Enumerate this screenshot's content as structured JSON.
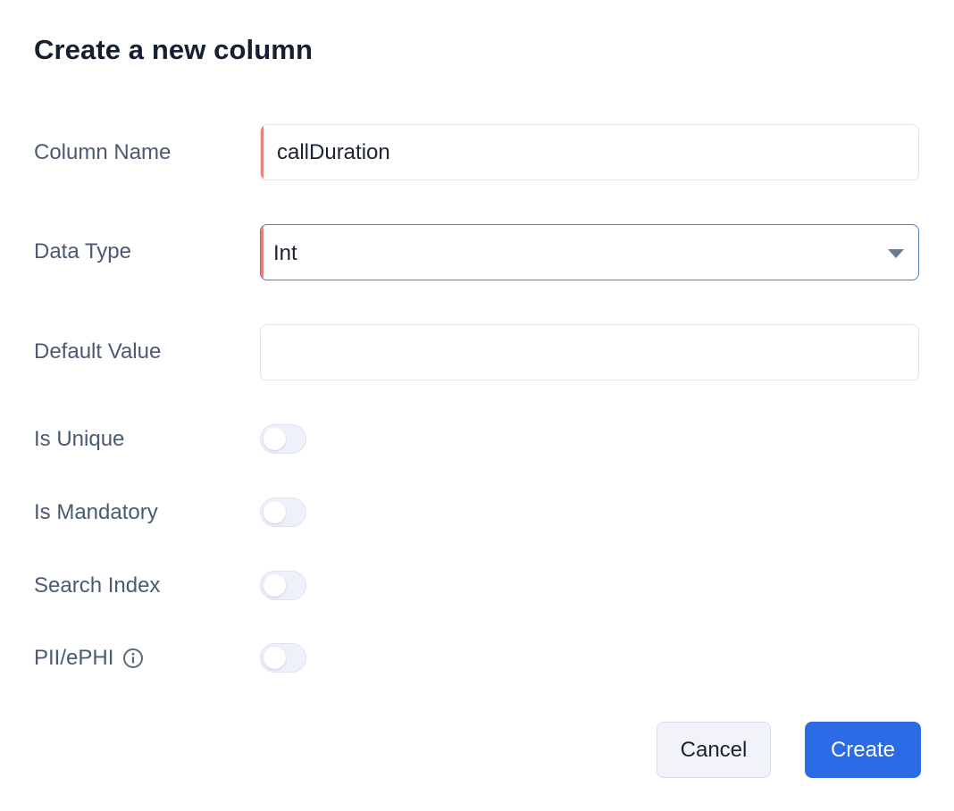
{
  "dialog": {
    "title": "Create a new column"
  },
  "form": {
    "column_name": {
      "label": "Column Name",
      "value": "callDuration"
    },
    "data_type": {
      "label": "Data Type",
      "value": "Int"
    },
    "default_value": {
      "label": "Default Value",
      "value": ""
    },
    "is_unique": {
      "label": "Is Unique",
      "enabled": false
    },
    "is_mandatory": {
      "label": "Is Mandatory",
      "enabled": false
    },
    "search_index": {
      "label": "Search Index",
      "enabled": false
    },
    "pii_ephi": {
      "label": "PII/ePHI",
      "enabled": false,
      "icon": "info-icon"
    }
  },
  "actions": {
    "cancel_label": "Cancel",
    "create_label": "Create"
  },
  "colors": {
    "primary": "#2b6be6",
    "required_marker": "#e9807c",
    "label": "#4b5a73",
    "title": "#141f33"
  }
}
